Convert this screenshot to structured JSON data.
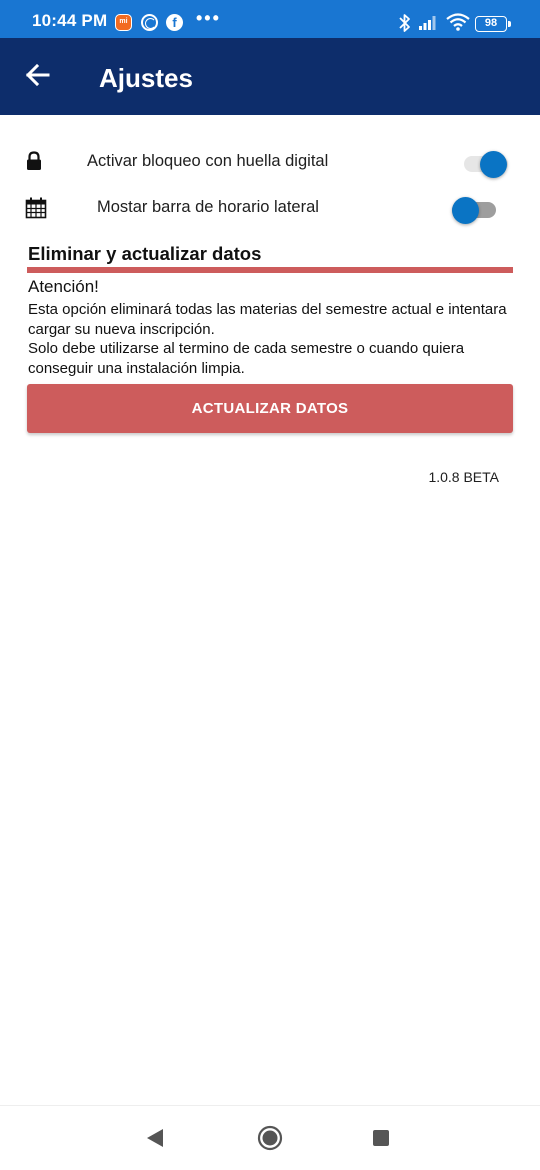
{
  "status_bar": {
    "time": "10:44 PM",
    "more_indicator": "•••",
    "battery": "98",
    "icons": [
      "mi-app-icon",
      "ring-app-icon",
      "facebook-icon",
      "bluetooth-icon",
      "signal-icon",
      "wifi-icon",
      "battery-icon"
    ],
    "background_color": "#1976d2"
  },
  "app_bar": {
    "title": "Ajustes",
    "back_icon": "arrow-left-icon",
    "background_color": "#0d2d6b"
  },
  "settings": {
    "fingerprint": {
      "icon": "lock-icon",
      "label": "Activar bloqueo con huella digital",
      "enabled": true
    },
    "schedule_bar": {
      "icon": "calendar-icon",
      "label": "Mostar barra de horario lateral",
      "enabled": false
    },
    "toggle_color": "#0a74c4"
  },
  "danger_section": {
    "title": "Eliminar y actualizar datos",
    "warning_title": "Atención!",
    "warning_line_1": "Esta opción eliminará todas las materias del semestre actual e intentara cargar su nueva inscripción.",
    "warning_line_2": "Solo debe utilizarse al termino de cada semestre o cuando quiera conseguir una instalación limpia.",
    "button_label": "ACTUALIZAR DATOS",
    "accent_color": "#cd5c5c"
  },
  "version": "1.0.8 BETA",
  "nav_bar": {
    "icons": [
      "nav-back-icon",
      "nav-home-icon",
      "nav-recents-icon"
    ]
  }
}
